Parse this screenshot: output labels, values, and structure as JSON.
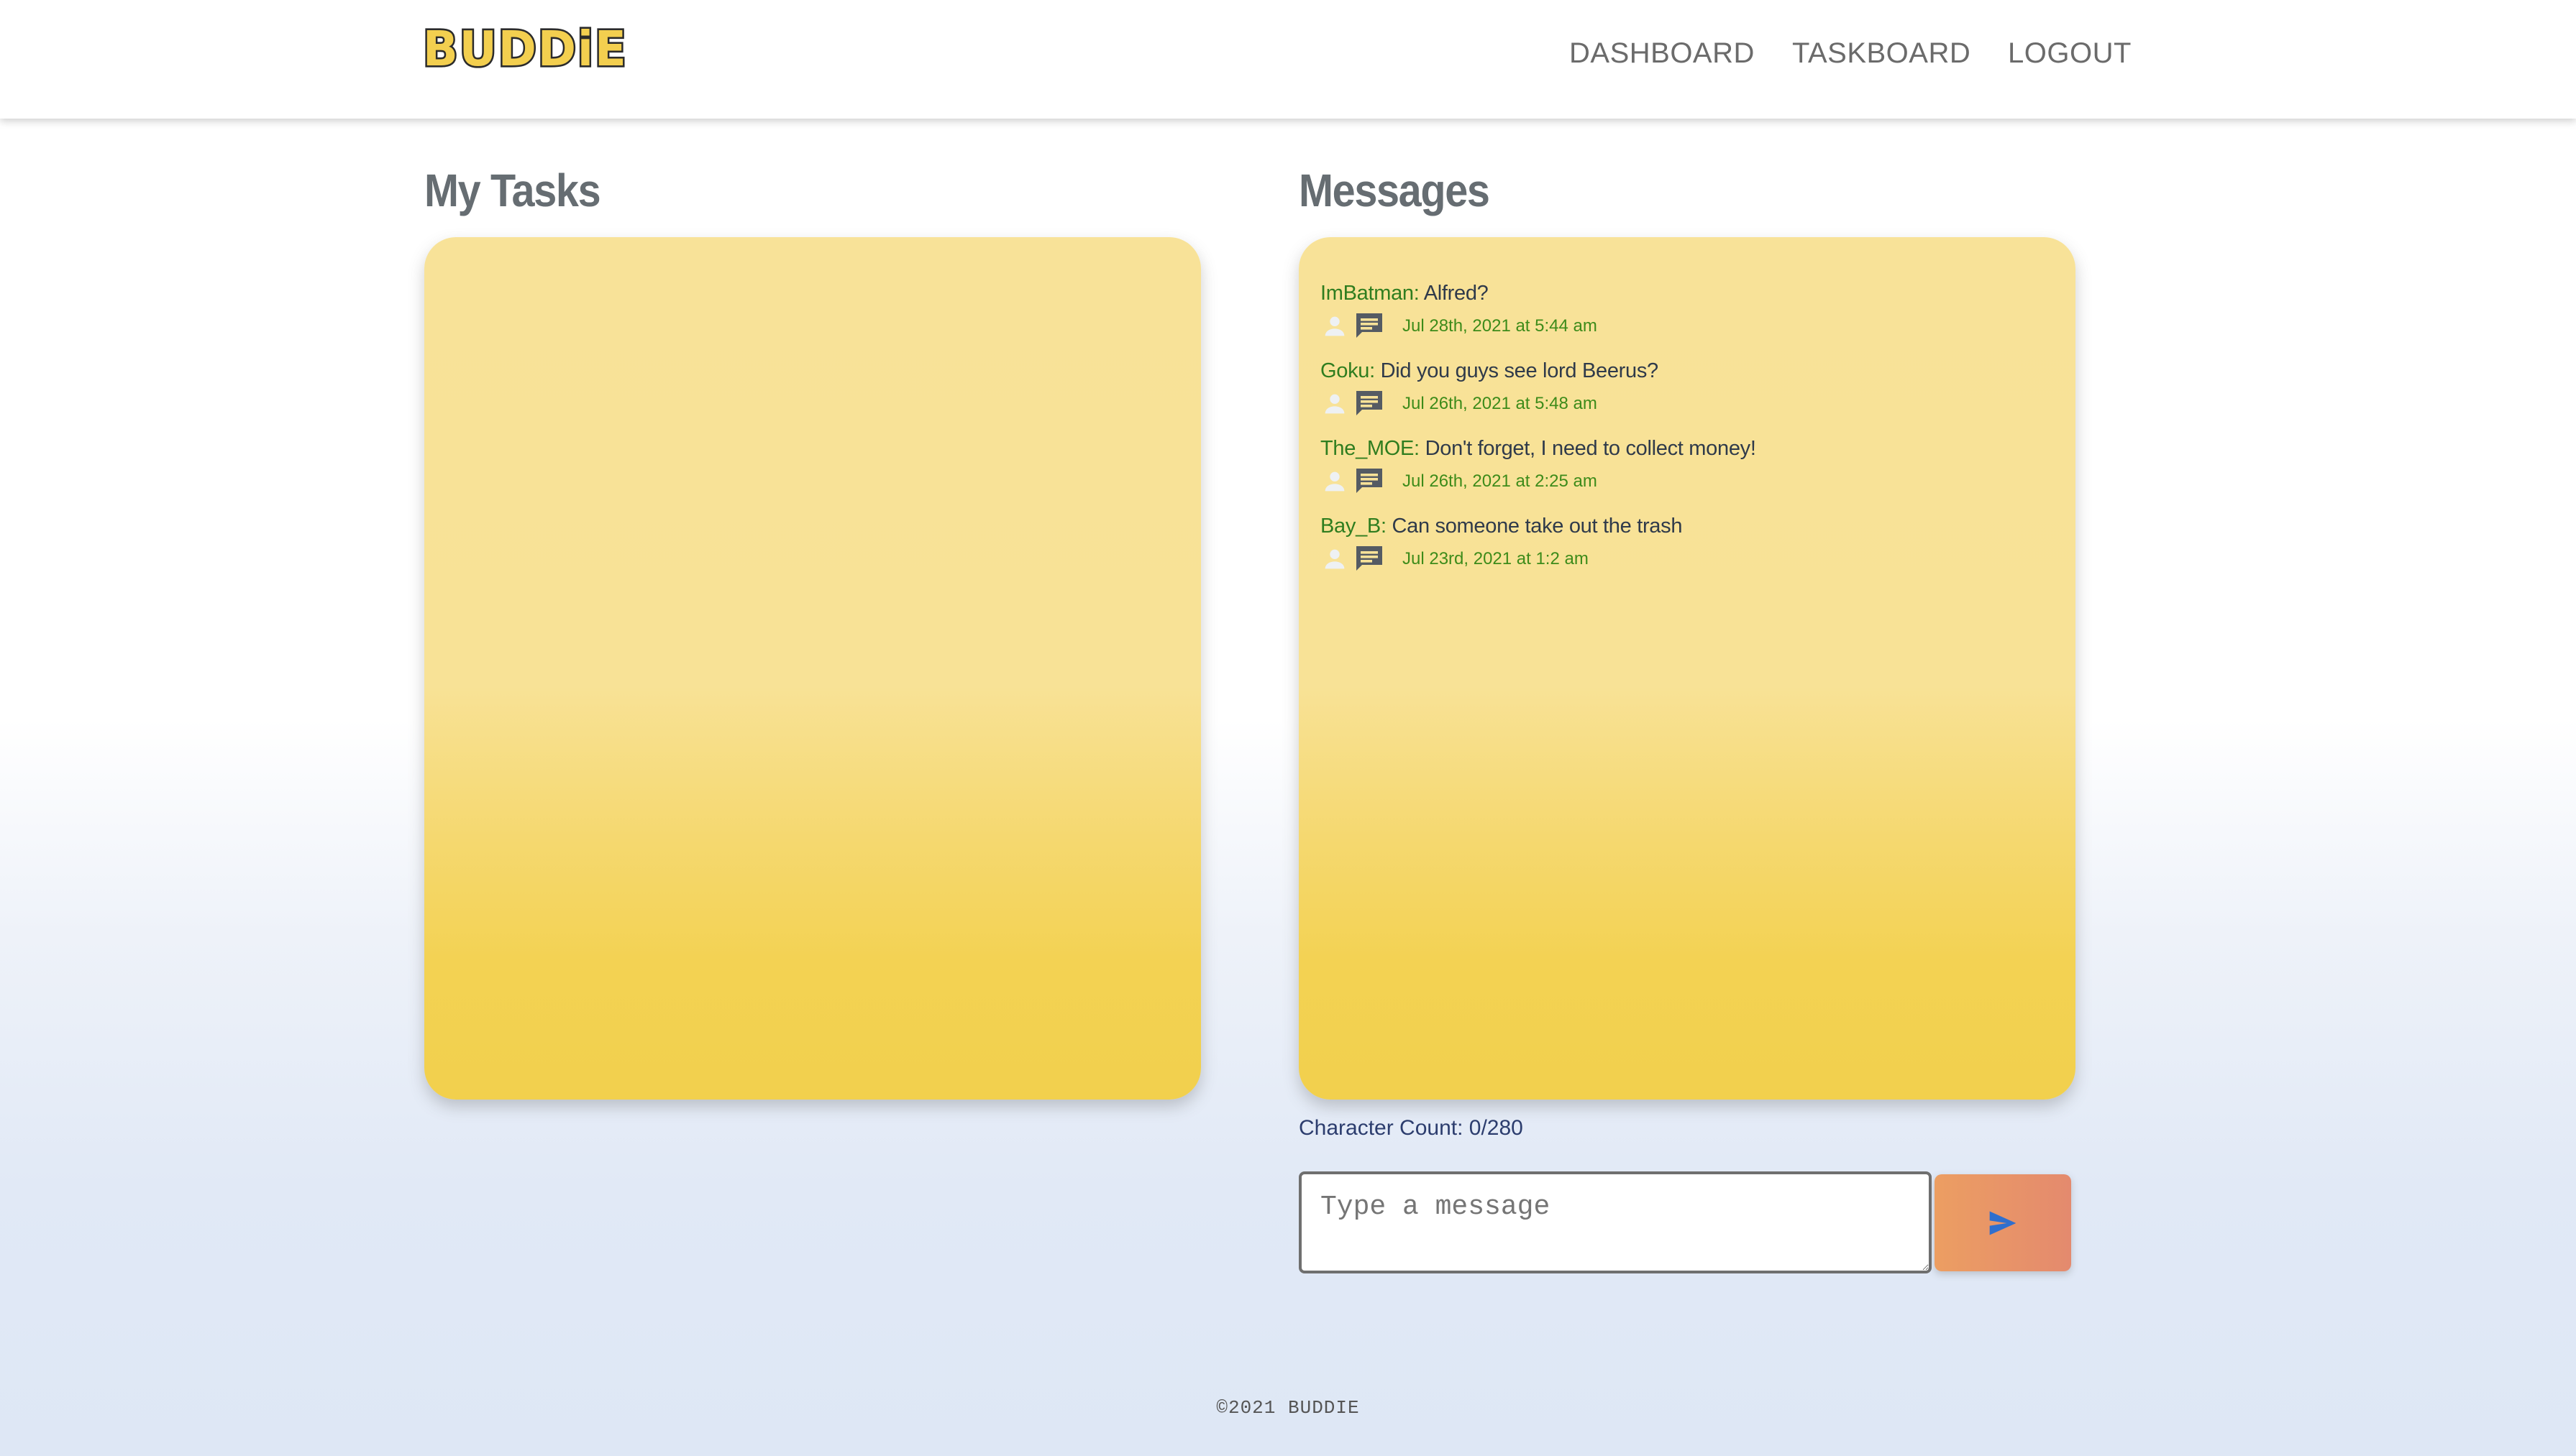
{
  "header": {
    "logo_text": "BUDDiE",
    "nav": [
      {
        "label": "DASHBOARD"
      },
      {
        "label": "TASKBOARD"
      },
      {
        "label": "LOGOUT"
      }
    ]
  },
  "tasks": {
    "title": "My Tasks",
    "items": []
  },
  "messages": {
    "title": "Messages",
    "items": [
      {
        "user": "ImBatman:",
        "text": "Alfred?",
        "date": "Jul 28th, 2021 at 5:44 am"
      },
      {
        "user": "Goku:",
        "text": "Did you guys see lord Beerus?",
        "date": "Jul 26th, 2021 at 5:48 am"
      },
      {
        "user": "The_MOE:",
        "text": "Don't forget, I need to collect money!",
        "date": "Jul 26th, 2021 at 2:25 am"
      },
      {
        "user": "Bay_B:",
        "text": "Can someone take out the trash",
        "date": "Jul 23rd, 2021 at 1:2 am"
      }
    ],
    "icons": {
      "user": "user-icon",
      "chat": "chat-icon"
    }
  },
  "composer": {
    "char_count": "Character Count: 0/280",
    "placeholder": "Type a message",
    "value": "",
    "send_icon": "send-icon"
  },
  "footer": {
    "copyright": "©2021 BUDDIE"
  },
  "colors": {
    "panel_top": "#f8e298",
    "panel_bottom": "#f2d04d",
    "username": "#2f7d1f",
    "send_button": "#e48a6e",
    "send_icon": "#2f6fce"
  }
}
